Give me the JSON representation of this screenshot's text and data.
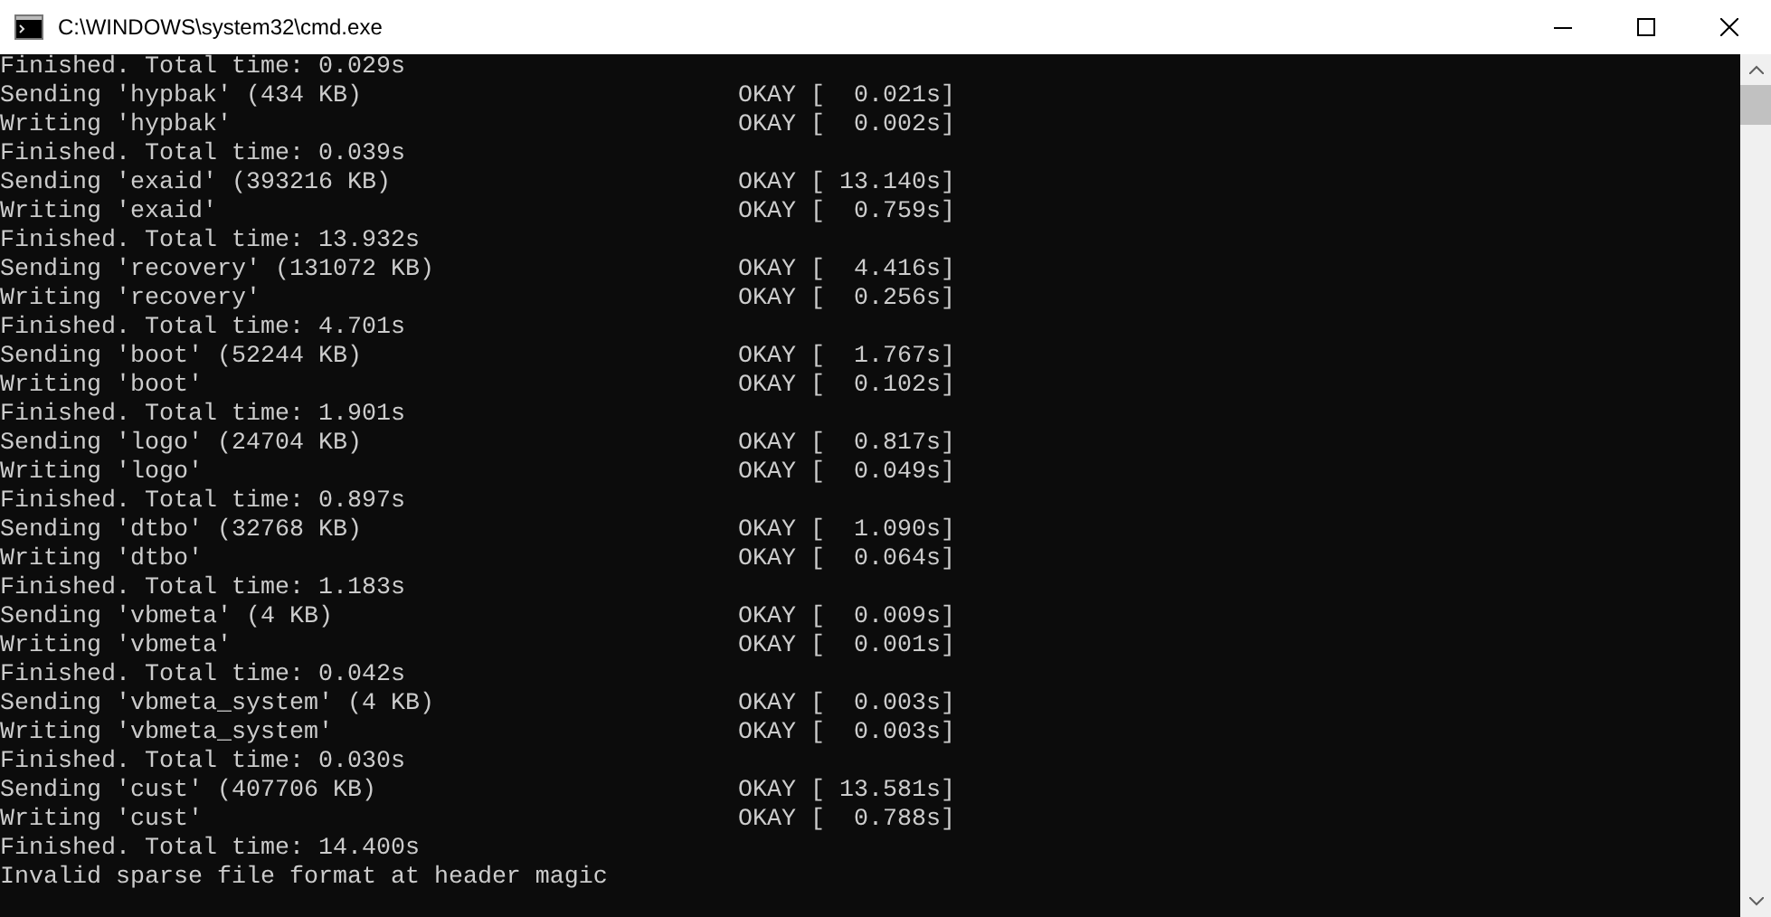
{
  "window": {
    "title": "C:\\WINDOWS\\system32\\cmd.exe"
  },
  "lines": [
    {
      "text": "Finished. Total time: 0.029s"
    },
    {
      "text": "Sending 'hypbak' (434 KB)",
      "status": "OKAY [  0.021s]"
    },
    {
      "text": "Writing 'hypbak'",
      "status": "OKAY [  0.002s]"
    },
    {
      "text": "Finished. Total time: 0.039s"
    },
    {
      "text": "Sending 'exaid' (393216 KB)",
      "status": "OKAY [ 13.140s]"
    },
    {
      "text": "Writing 'exaid'",
      "status": "OKAY [  0.759s]"
    },
    {
      "text": "Finished. Total time: 13.932s"
    },
    {
      "text": "Sending 'recovery' (131072 KB)",
      "status": "OKAY [  4.416s]"
    },
    {
      "text": "Writing 'recovery'",
      "status": "OKAY [  0.256s]"
    },
    {
      "text": "Finished. Total time: 4.701s"
    },
    {
      "text": "Sending 'boot' (52244 KB)",
      "status": "OKAY [  1.767s]"
    },
    {
      "text": "Writing 'boot'",
      "status": "OKAY [  0.102s]"
    },
    {
      "text": "Finished. Total time: 1.901s"
    },
    {
      "text": "Sending 'logo' (24704 KB)",
      "status": "OKAY [  0.817s]"
    },
    {
      "text": "Writing 'logo'",
      "status": "OKAY [  0.049s]"
    },
    {
      "text": "Finished. Total time: 0.897s"
    },
    {
      "text": "Sending 'dtbo' (32768 KB)",
      "status": "OKAY [  1.090s]"
    },
    {
      "text": "Writing 'dtbo'",
      "status": "OKAY [  0.064s]"
    },
    {
      "text": "Finished. Total time: 1.183s"
    },
    {
      "text": "Sending 'vbmeta' (4 KB)",
      "status": "OKAY [  0.009s]"
    },
    {
      "text": "Writing 'vbmeta'",
      "status": "OKAY [  0.001s]"
    },
    {
      "text": "Finished. Total time: 0.042s"
    },
    {
      "text": "Sending 'vbmeta_system' (4 KB)",
      "status": "OKAY [  0.003s]"
    },
    {
      "text": "Writing 'vbmeta_system'",
      "status": "OKAY [  0.003s]"
    },
    {
      "text": "Finished. Total time: 0.030s"
    },
    {
      "text": "Sending 'cust' (407706 KB)",
      "status": "OKAY [ 13.581s]"
    },
    {
      "text": "Writing 'cust'",
      "status": "OKAY [  0.788s]"
    },
    {
      "text": "Finished. Total time: 14.400s"
    },
    {
      "text": "Invalid sparse file format at header magic"
    }
  ]
}
